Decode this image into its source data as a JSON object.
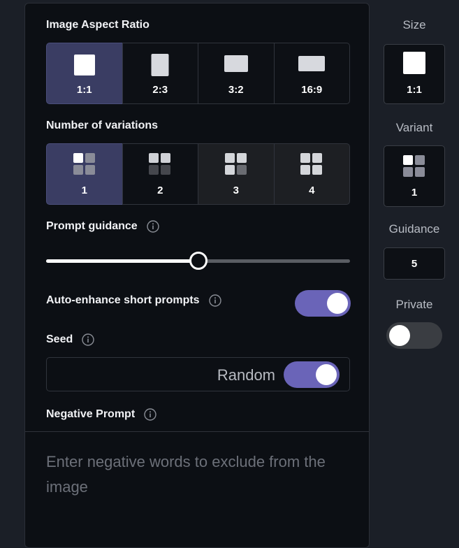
{
  "aspect": {
    "label": "Image Aspect Ratio",
    "options": [
      {
        "value": "1:1",
        "selected": true,
        "shape-icon": "square-icon"
      },
      {
        "value": "2:3",
        "selected": false,
        "shape-icon": "portrait-rect-icon"
      },
      {
        "value": "3:2",
        "selected": false,
        "shape-icon": "landscape-rect-icon"
      },
      {
        "value": "16:9",
        "selected": false,
        "shape-icon": "wide-rect-icon"
      }
    ]
  },
  "variations": {
    "label": "Number of variations",
    "options": [
      {
        "value": "1",
        "selected": true
      },
      {
        "value": "2",
        "selected": false
      },
      {
        "value": "3",
        "selected": false
      },
      {
        "value": "4",
        "selected": false
      }
    ]
  },
  "guidance": {
    "label": "Prompt guidance",
    "value": 5,
    "min": 0,
    "max": 10
  },
  "auto_enhance": {
    "label": "Auto-enhance short prompts",
    "enabled": true
  },
  "seed": {
    "label": "Seed",
    "value": "Random",
    "random_enabled": true
  },
  "negative": {
    "label": "Negative Prompt",
    "placeholder": "Enter negative words to exclude from the image"
  },
  "sidebar": {
    "size_label": "Size",
    "size_value": "1:1",
    "variant_label": "Variant",
    "variant_value": "1",
    "guidance_label": "Guidance",
    "guidance_value": "5",
    "private_label": "Private",
    "private_enabled": false
  },
  "colors": {
    "accent": "#6a64b8",
    "selected_bg": "#3a3d63",
    "panel_bg": "#0c0f14",
    "page_bg": "#1b1f27"
  }
}
